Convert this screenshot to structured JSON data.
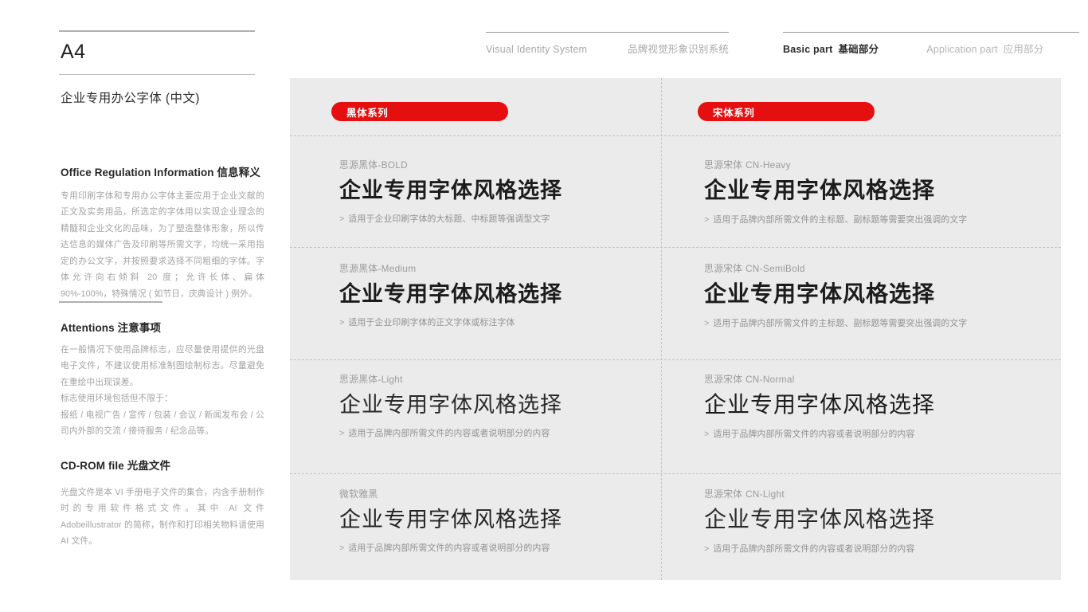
{
  "header": {
    "vis_en": "Visual Identity System",
    "vis_cn": "品牌视觉形象识别系统",
    "basic_en": "Basic part",
    "basic_cn": "基础部分",
    "app_en": "Application part",
    "app_cn": "应用部分"
  },
  "sidebar": {
    "page_code": "A4",
    "subtitle": "企业专用办公字体 (中文)",
    "sections": [
      {
        "heading_en": "Office Regulation Information",
        "heading_cn": "信息释义",
        "body": "专用印刷字体和专用办公字体主要应用于企业文献的正文及实务用品，所选定的字体用以实现企业理念的精髓和企业文化的品味，为了塑造整体形象，所以传达信息的媒体广告及印刷等所需文字，均统一采用指定的办公文字，并按照要求选择不同粗细的字体。字体允许向右倾斜 20 度；允许长体、扁体 90%-100%，特殊情况 ( 如节日，庆典设计 ) 例外。"
      },
      {
        "heading_en": "Attentions",
        "heading_cn": "注意事项",
        "body_1": "在一般情况下使用品牌标志，应尽量使用提供的光盘电子文件，不建议使用标准制图绘制标志。尽量避免在重绘中出现误差。",
        "body_2": "标志使用环境包括但不限于：",
        "body_3": "报纸 / 电视广告 / 宣传 / 包装 / 会议 / 新闻发布会 / 公司内外部的交流 / 接待服务 / 纪念品等。"
      },
      {
        "heading_en": "CD-ROM file",
        "heading_cn": "光盘文件",
        "body": "光盘文件是本 VI 手册电子文件的集合，内含手册制作时的专用软件格式文件。其中 AI 文件 Adobeillustrator 的简称，制作和打印相关物料请使用 AI 文件。"
      }
    ]
  },
  "panel": {
    "accent_color": "#e60f0f",
    "background_color": "#ebebeb",
    "pill_left": "黑体系列",
    "pill_right": "宋体系列",
    "specimen_text": "企业专用字体风格选择",
    "samples_left": [
      {
        "name": "思源黑体-BOLD",
        "specimen": "企业专用字体风格选择",
        "usage": "适用于企业印刷字体的大标题、中标题等强调型文字"
      },
      {
        "name": "思源黑体-Medium",
        "specimen": "企业专用字体风格选择",
        "usage": "适用于企业印刷字体的正文字体或标注字体"
      },
      {
        "name": "思源黑体-Light",
        "specimen": "企业专用字体风格选择",
        "usage": "适用于品牌内部所需文件的内容或者说明部分的内容"
      },
      {
        "name": "微软雅黑",
        "specimen": "企业专用字体风格选择",
        "usage": "适用于品牌内部所需文件的内容或者说明部分的内容"
      }
    ],
    "samples_right": [
      {
        "name": "思源宋体 CN-Heavy",
        "specimen": "企业专用字体风格选择",
        "usage": "适用于品牌内部所需文件的主标题、副标题等需要突出强调的文字"
      },
      {
        "name": "思源宋体 CN-SemiBold",
        "specimen": "企业专用字体风格选择",
        "usage": "适用于品牌内部所需文件的主标题、副标题等需要突出强调的文字"
      },
      {
        "name": "思源宋体 CN-Normal",
        "specimen": "企业专用字体风格选择",
        "usage": "适用于品牌内部所需文件的内容或者说明部分的内容"
      },
      {
        "name": "思源宋体 CN-Light",
        "specimen": "企业专用字体风格选择",
        "usage": "适用于品牌内部所需文件的内容或者说明部分的内容"
      }
    ],
    "usage_arrow": ">"
  }
}
